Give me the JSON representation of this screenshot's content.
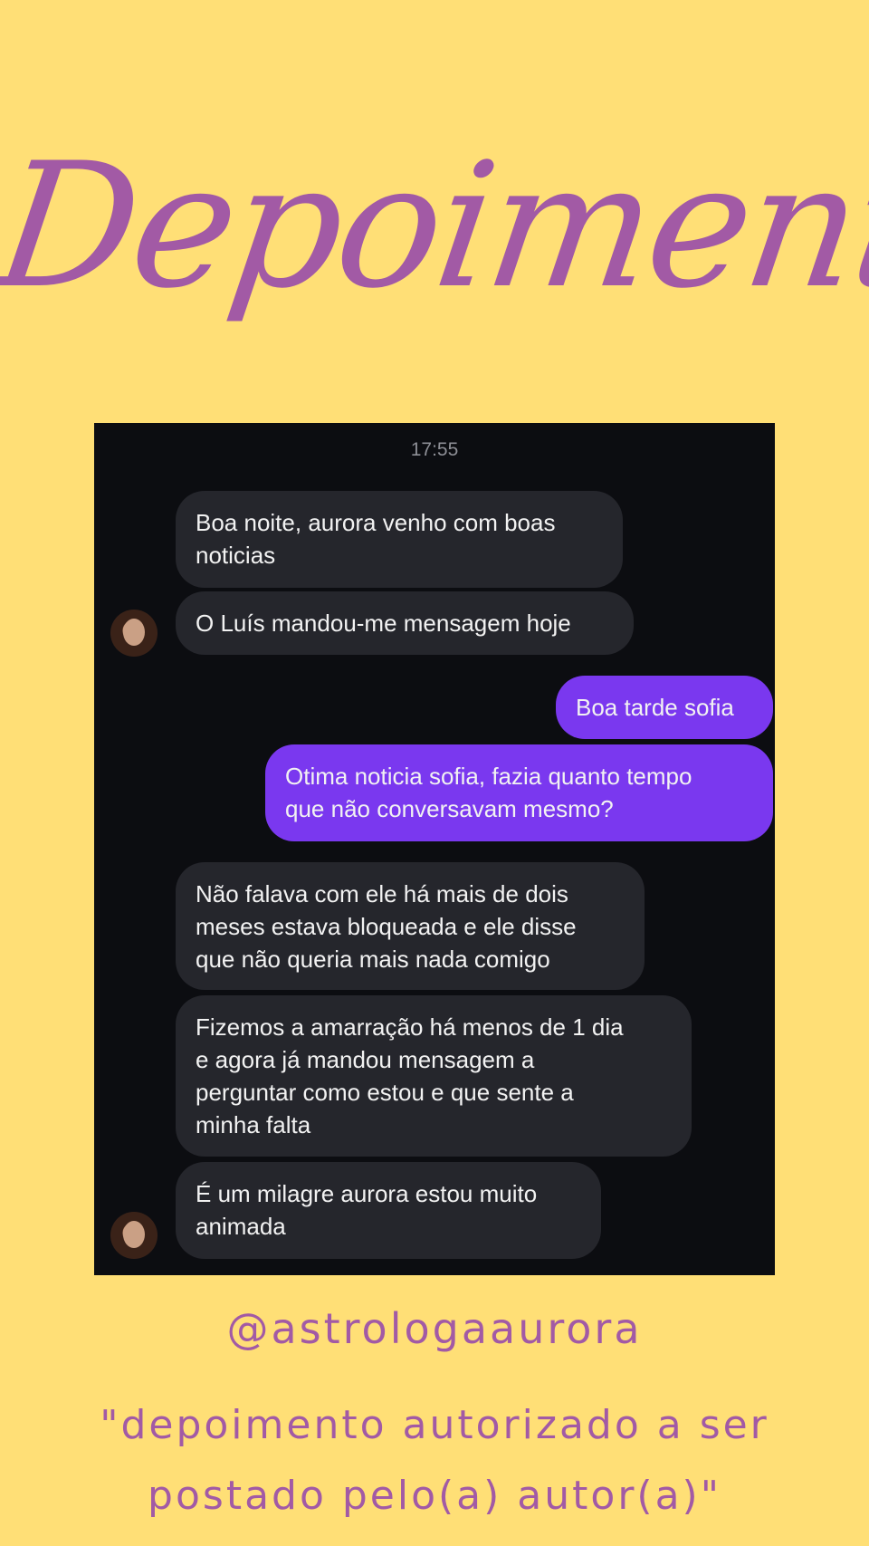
{
  "header": {
    "title": "Depoimentos"
  },
  "chat": {
    "timestamp": "17:55",
    "messages": [
      {
        "from": "received",
        "text": "Boa noite, aurora venho com boas\nnoticias"
      },
      {
        "from": "received",
        "text": "O Luís mandou-me mensagem hoje"
      },
      {
        "from": "sent",
        "text": "Boa tarde sofia"
      },
      {
        "from": "sent",
        "text": "Otima noticia sofia, fazia quanto tempo\nque não conversavam mesmo?"
      },
      {
        "from": "received",
        "text": "Não falava com ele há mais de dois\nmeses estava bloqueada e ele disse\nque não queria mais nada comigo"
      },
      {
        "from": "received",
        "text": "Fizemos a amarração há menos de 1 dia\ne agora já mandou mensagem a\nperguntar como estou e que sente a\nminha falta"
      },
      {
        "from": "received",
        "text": "É um milagre aurora estou muito\nanimada"
      }
    ]
  },
  "footer": {
    "handle": "@astrologaaurora",
    "note": "\"depoimento autorizado a ser postado pelo(a) autor(a)\""
  },
  "colors": {
    "background": "#ffdf76",
    "accent": "#a25aa5",
    "sent_bubble": "#7a38ef",
    "received_bubble": "#25262c",
    "chat_background": "#0c0d11"
  }
}
